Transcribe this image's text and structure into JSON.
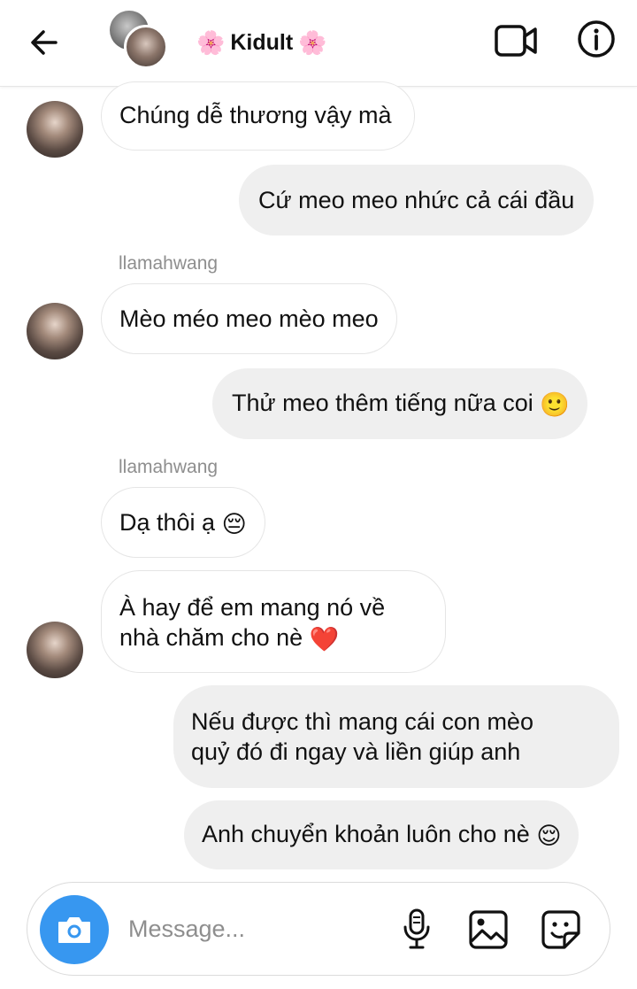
{
  "header": {
    "title": "Kidult",
    "title_emoji": "🌸"
  },
  "messages": [
    {
      "side": "in",
      "text": "Chúng dễ thương vậy mà"
    },
    {
      "side": "out",
      "text": "Cứ meo meo nhức cả cái đầu"
    },
    {
      "side": "in",
      "sender": "llamahwang",
      "text": "Mèo méo meo mèo meo"
    },
    {
      "side": "out",
      "text": "Thử meo thêm tiếng nữa coi",
      "emoji": "🙂"
    },
    {
      "side": "in",
      "sender": "llamahwang",
      "text": "Dạ thôi ạ",
      "emoji": "😔"
    },
    {
      "side": "in",
      "line1": "À hay để em mang nó về",
      "line2": "nhà chăm cho nè",
      "emoji": "❤️"
    },
    {
      "side": "out",
      "line1": "Nếu được thì mang cái con mèo",
      "line2": "quỷ đó đi ngay và liền giúp anh"
    },
    {
      "side": "out",
      "text": "Anh chuyển khoản luôn cho nè",
      "emoji": "😌"
    }
  ],
  "composer": {
    "placeholder": "Message..."
  },
  "icons": {
    "back": "arrow-left-icon",
    "video": "video-camera-icon",
    "info": "info-icon",
    "camera": "camera-icon",
    "mic": "microphone-icon",
    "gallery": "image-icon",
    "sticker": "sticker-icon"
  },
  "colors": {
    "accent": "#3797f0",
    "outgoing_bubble": "#efefef",
    "incoming_border": "#e5e5e5",
    "sender_label": "#8e8e8e",
    "heart": "#e0182d"
  }
}
